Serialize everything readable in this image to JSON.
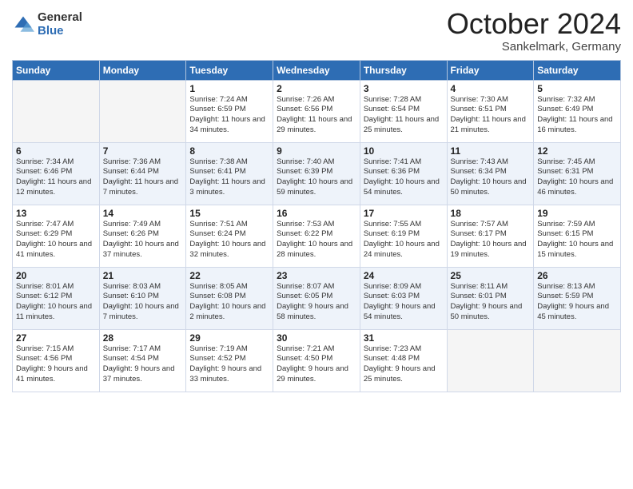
{
  "logo": {
    "general": "General",
    "blue": "Blue"
  },
  "header": {
    "title": "October 2024",
    "subtitle": "Sankelmark, Germany"
  },
  "weekdays": [
    "Sunday",
    "Monday",
    "Tuesday",
    "Wednesday",
    "Thursday",
    "Friday",
    "Saturday"
  ],
  "weeks": [
    [
      {
        "day": "",
        "empty": true
      },
      {
        "day": "",
        "empty": true
      },
      {
        "day": "1",
        "sunrise": "Sunrise: 7:24 AM",
        "sunset": "Sunset: 6:59 PM",
        "daylight": "Daylight: 11 hours and 34 minutes."
      },
      {
        "day": "2",
        "sunrise": "Sunrise: 7:26 AM",
        "sunset": "Sunset: 6:56 PM",
        "daylight": "Daylight: 11 hours and 29 minutes."
      },
      {
        "day": "3",
        "sunrise": "Sunrise: 7:28 AM",
        "sunset": "Sunset: 6:54 PM",
        "daylight": "Daylight: 11 hours and 25 minutes."
      },
      {
        "day": "4",
        "sunrise": "Sunrise: 7:30 AM",
        "sunset": "Sunset: 6:51 PM",
        "daylight": "Daylight: 11 hours and 21 minutes."
      },
      {
        "day": "5",
        "sunrise": "Sunrise: 7:32 AM",
        "sunset": "Sunset: 6:49 PM",
        "daylight": "Daylight: 11 hours and 16 minutes."
      }
    ],
    [
      {
        "day": "6",
        "sunrise": "Sunrise: 7:34 AM",
        "sunset": "Sunset: 6:46 PM",
        "daylight": "Daylight: 11 hours and 12 minutes."
      },
      {
        "day": "7",
        "sunrise": "Sunrise: 7:36 AM",
        "sunset": "Sunset: 6:44 PM",
        "daylight": "Daylight: 11 hours and 7 minutes."
      },
      {
        "day": "8",
        "sunrise": "Sunrise: 7:38 AM",
        "sunset": "Sunset: 6:41 PM",
        "daylight": "Daylight: 11 hours and 3 minutes."
      },
      {
        "day": "9",
        "sunrise": "Sunrise: 7:40 AM",
        "sunset": "Sunset: 6:39 PM",
        "daylight": "Daylight: 10 hours and 59 minutes."
      },
      {
        "day": "10",
        "sunrise": "Sunrise: 7:41 AM",
        "sunset": "Sunset: 6:36 PM",
        "daylight": "Daylight: 10 hours and 54 minutes."
      },
      {
        "day": "11",
        "sunrise": "Sunrise: 7:43 AM",
        "sunset": "Sunset: 6:34 PM",
        "daylight": "Daylight: 10 hours and 50 minutes."
      },
      {
        "day": "12",
        "sunrise": "Sunrise: 7:45 AM",
        "sunset": "Sunset: 6:31 PM",
        "daylight": "Daylight: 10 hours and 46 minutes."
      }
    ],
    [
      {
        "day": "13",
        "sunrise": "Sunrise: 7:47 AM",
        "sunset": "Sunset: 6:29 PM",
        "daylight": "Daylight: 10 hours and 41 minutes."
      },
      {
        "day": "14",
        "sunrise": "Sunrise: 7:49 AM",
        "sunset": "Sunset: 6:26 PM",
        "daylight": "Daylight: 10 hours and 37 minutes."
      },
      {
        "day": "15",
        "sunrise": "Sunrise: 7:51 AM",
        "sunset": "Sunset: 6:24 PM",
        "daylight": "Daylight: 10 hours and 32 minutes."
      },
      {
        "day": "16",
        "sunrise": "Sunrise: 7:53 AM",
        "sunset": "Sunset: 6:22 PM",
        "daylight": "Daylight: 10 hours and 28 minutes."
      },
      {
        "day": "17",
        "sunrise": "Sunrise: 7:55 AM",
        "sunset": "Sunset: 6:19 PM",
        "daylight": "Daylight: 10 hours and 24 minutes."
      },
      {
        "day": "18",
        "sunrise": "Sunrise: 7:57 AM",
        "sunset": "Sunset: 6:17 PM",
        "daylight": "Daylight: 10 hours and 19 minutes."
      },
      {
        "day": "19",
        "sunrise": "Sunrise: 7:59 AM",
        "sunset": "Sunset: 6:15 PM",
        "daylight": "Daylight: 10 hours and 15 minutes."
      }
    ],
    [
      {
        "day": "20",
        "sunrise": "Sunrise: 8:01 AM",
        "sunset": "Sunset: 6:12 PM",
        "daylight": "Daylight: 10 hours and 11 minutes."
      },
      {
        "day": "21",
        "sunrise": "Sunrise: 8:03 AM",
        "sunset": "Sunset: 6:10 PM",
        "daylight": "Daylight: 10 hours and 7 minutes."
      },
      {
        "day": "22",
        "sunrise": "Sunrise: 8:05 AM",
        "sunset": "Sunset: 6:08 PM",
        "daylight": "Daylight: 10 hours and 2 minutes."
      },
      {
        "day": "23",
        "sunrise": "Sunrise: 8:07 AM",
        "sunset": "Sunset: 6:05 PM",
        "daylight": "Daylight: 9 hours and 58 minutes."
      },
      {
        "day": "24",
        "sunrise": "Sunrise: 8:09 AM",
        "sunset": "Sunset: 6:03 PM",
        "daylight": "Daylight: 9 hours and 54 minutes."
      },
      {
        "day": "25",
        "sunrise": "Sunrise: 8:11 AM",
        "sunset": "Sunset: 6:01 PM",
        "daylight": "Daylight: 9 hours and 50 minutes."
      },
      {
        "day": "26",
        "sunrise": "Sunrise: 8:13 AM",
        "sunset": "Sunset: 5:59 PM",
        "daylight": "Daylight: 9 hours and 45 minutes."
      }
    ],
    [
      {
        "day": "27",
        "sunrise": "Sunrise: 7:15 AM",
        "sunset": "Sunset: 4:56 PM",
        "daylight": "Daylight: 9 hours and 41 minutes."
      },
      {
        "day": "28",
        "sunrise": "Sunrise: 7:17 AM",
        "sunset": "Sunset: 4:54 PM",
        "daylight": "Daylight: 9 hours and 37 minutes."
      },
      {
        "day": "29",
        "sunrise": "Sunrise: 7:19 AM",
        "sunset": "Sunset: 4:52 PM",
        "daylight": "Daylight: 9 hours and 33 minutes."
      },
      {
        "day": "30",
        "sunrise": "Sunrise: 7:21 AM",
        "sunset": "Sunset: 4:50 PM",
        "daylight": "Daylight: 9 hours and 29 minutes."
      },
      {
        "day": "31",
        "sunrise": "Sunrise: 7:23 AM",
        "sunset": "Sunset: 4:48 PM",
        "daylight": "Daylight: 9 hours and 25 minutes."
      },
      {
        "day": "",
        "empty": true
      },
      {
        "day": "",
        "empty": true
      }
    ]
  ]
}
